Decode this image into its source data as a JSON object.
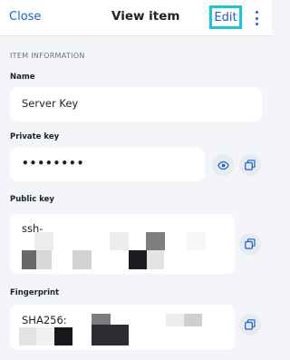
{
  "header": {
    "close_label": "Close",
    "title": "View item",
    "edit_label": "Edit"
  },
  "section": {
    "heading": "ITEM INFORMATION"
  },
  "fields": {
    "name": {
      "label": "Name",
      "value": "Server Key"
    },
    "private_key": {
      "label": "Private key",
      "value": "••••••••"
    },
    "public_key": {
      "label": "Public key",
      "value": "ssh-"
    },
    "fingerprint": {
      "label": "Fingerprint",
      "value": "SHA256:"
    }
  },
  "icons": {
    "more": "more-vertical-icon",
    "eye": "eye-icon",
    "copy": "copy-icon"
  },
  "colors": {
    "accent": "#175ddc",
    "highlight": "#19c8d8",
    "background": "#f3f5f8",
    "card": "#ffffff"
  }
}
